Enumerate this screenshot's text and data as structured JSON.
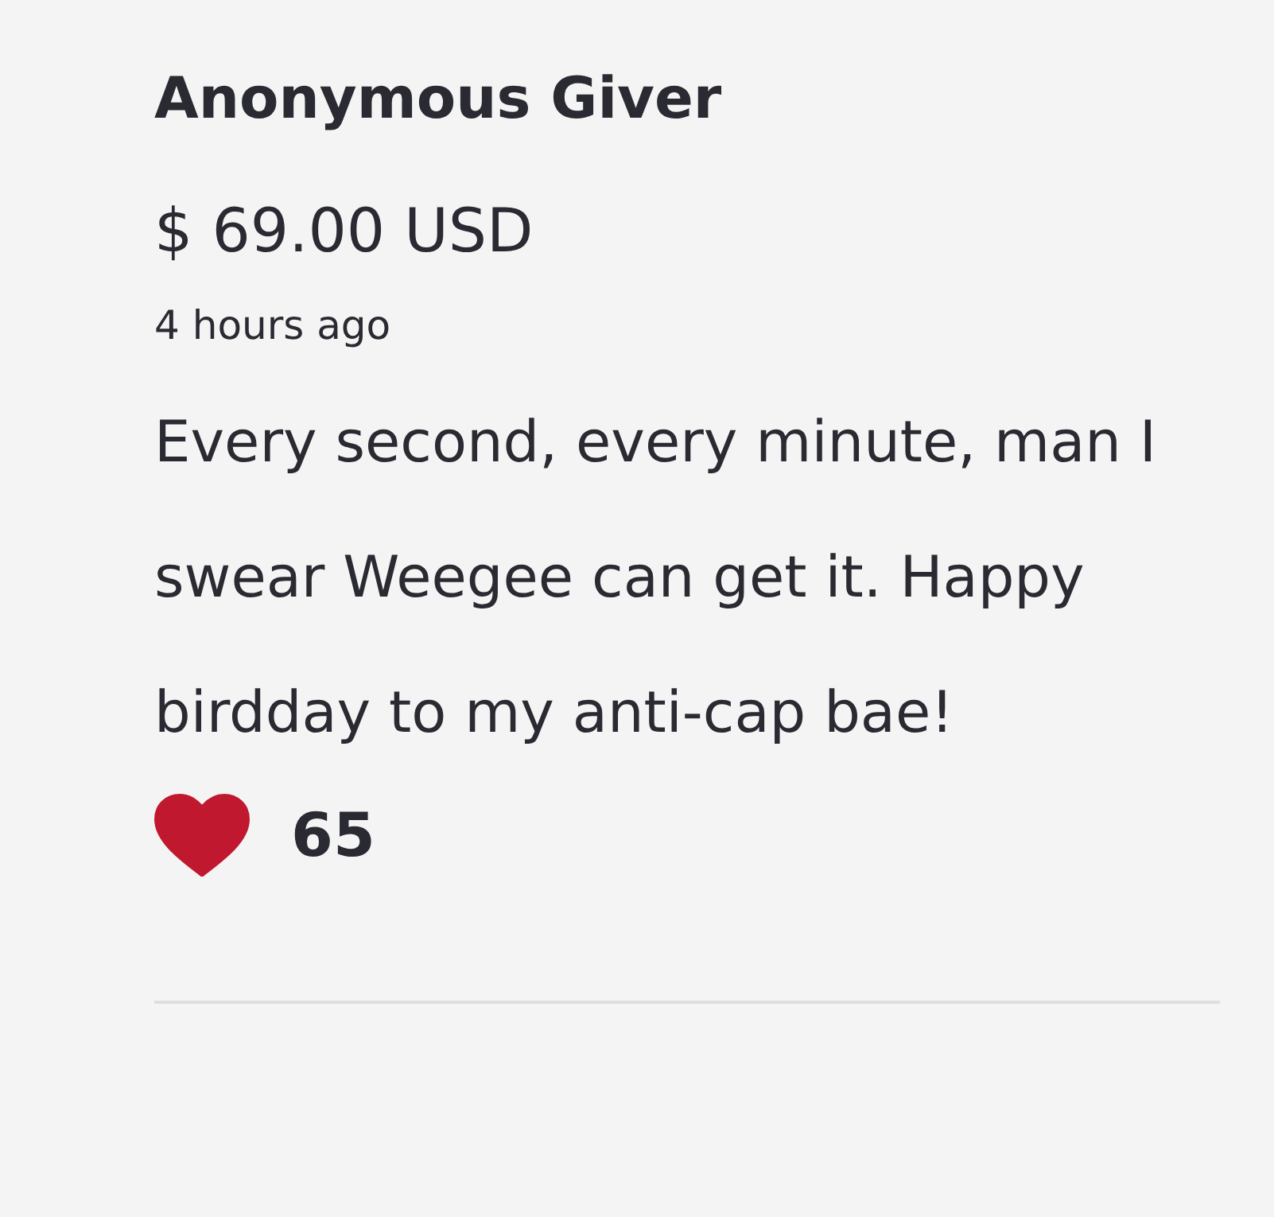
{
  "donation": {
    "donor": "Anonymous Giver",
    "amount": "$ 69.00 USD",
    "time": "4 hours ago",
    "message": "Every second, every minute, man I swear Weegee can get it. Happy birdday to my anti-cap bae!",
    "liked": true,
    "likes": "65"
  }
}
